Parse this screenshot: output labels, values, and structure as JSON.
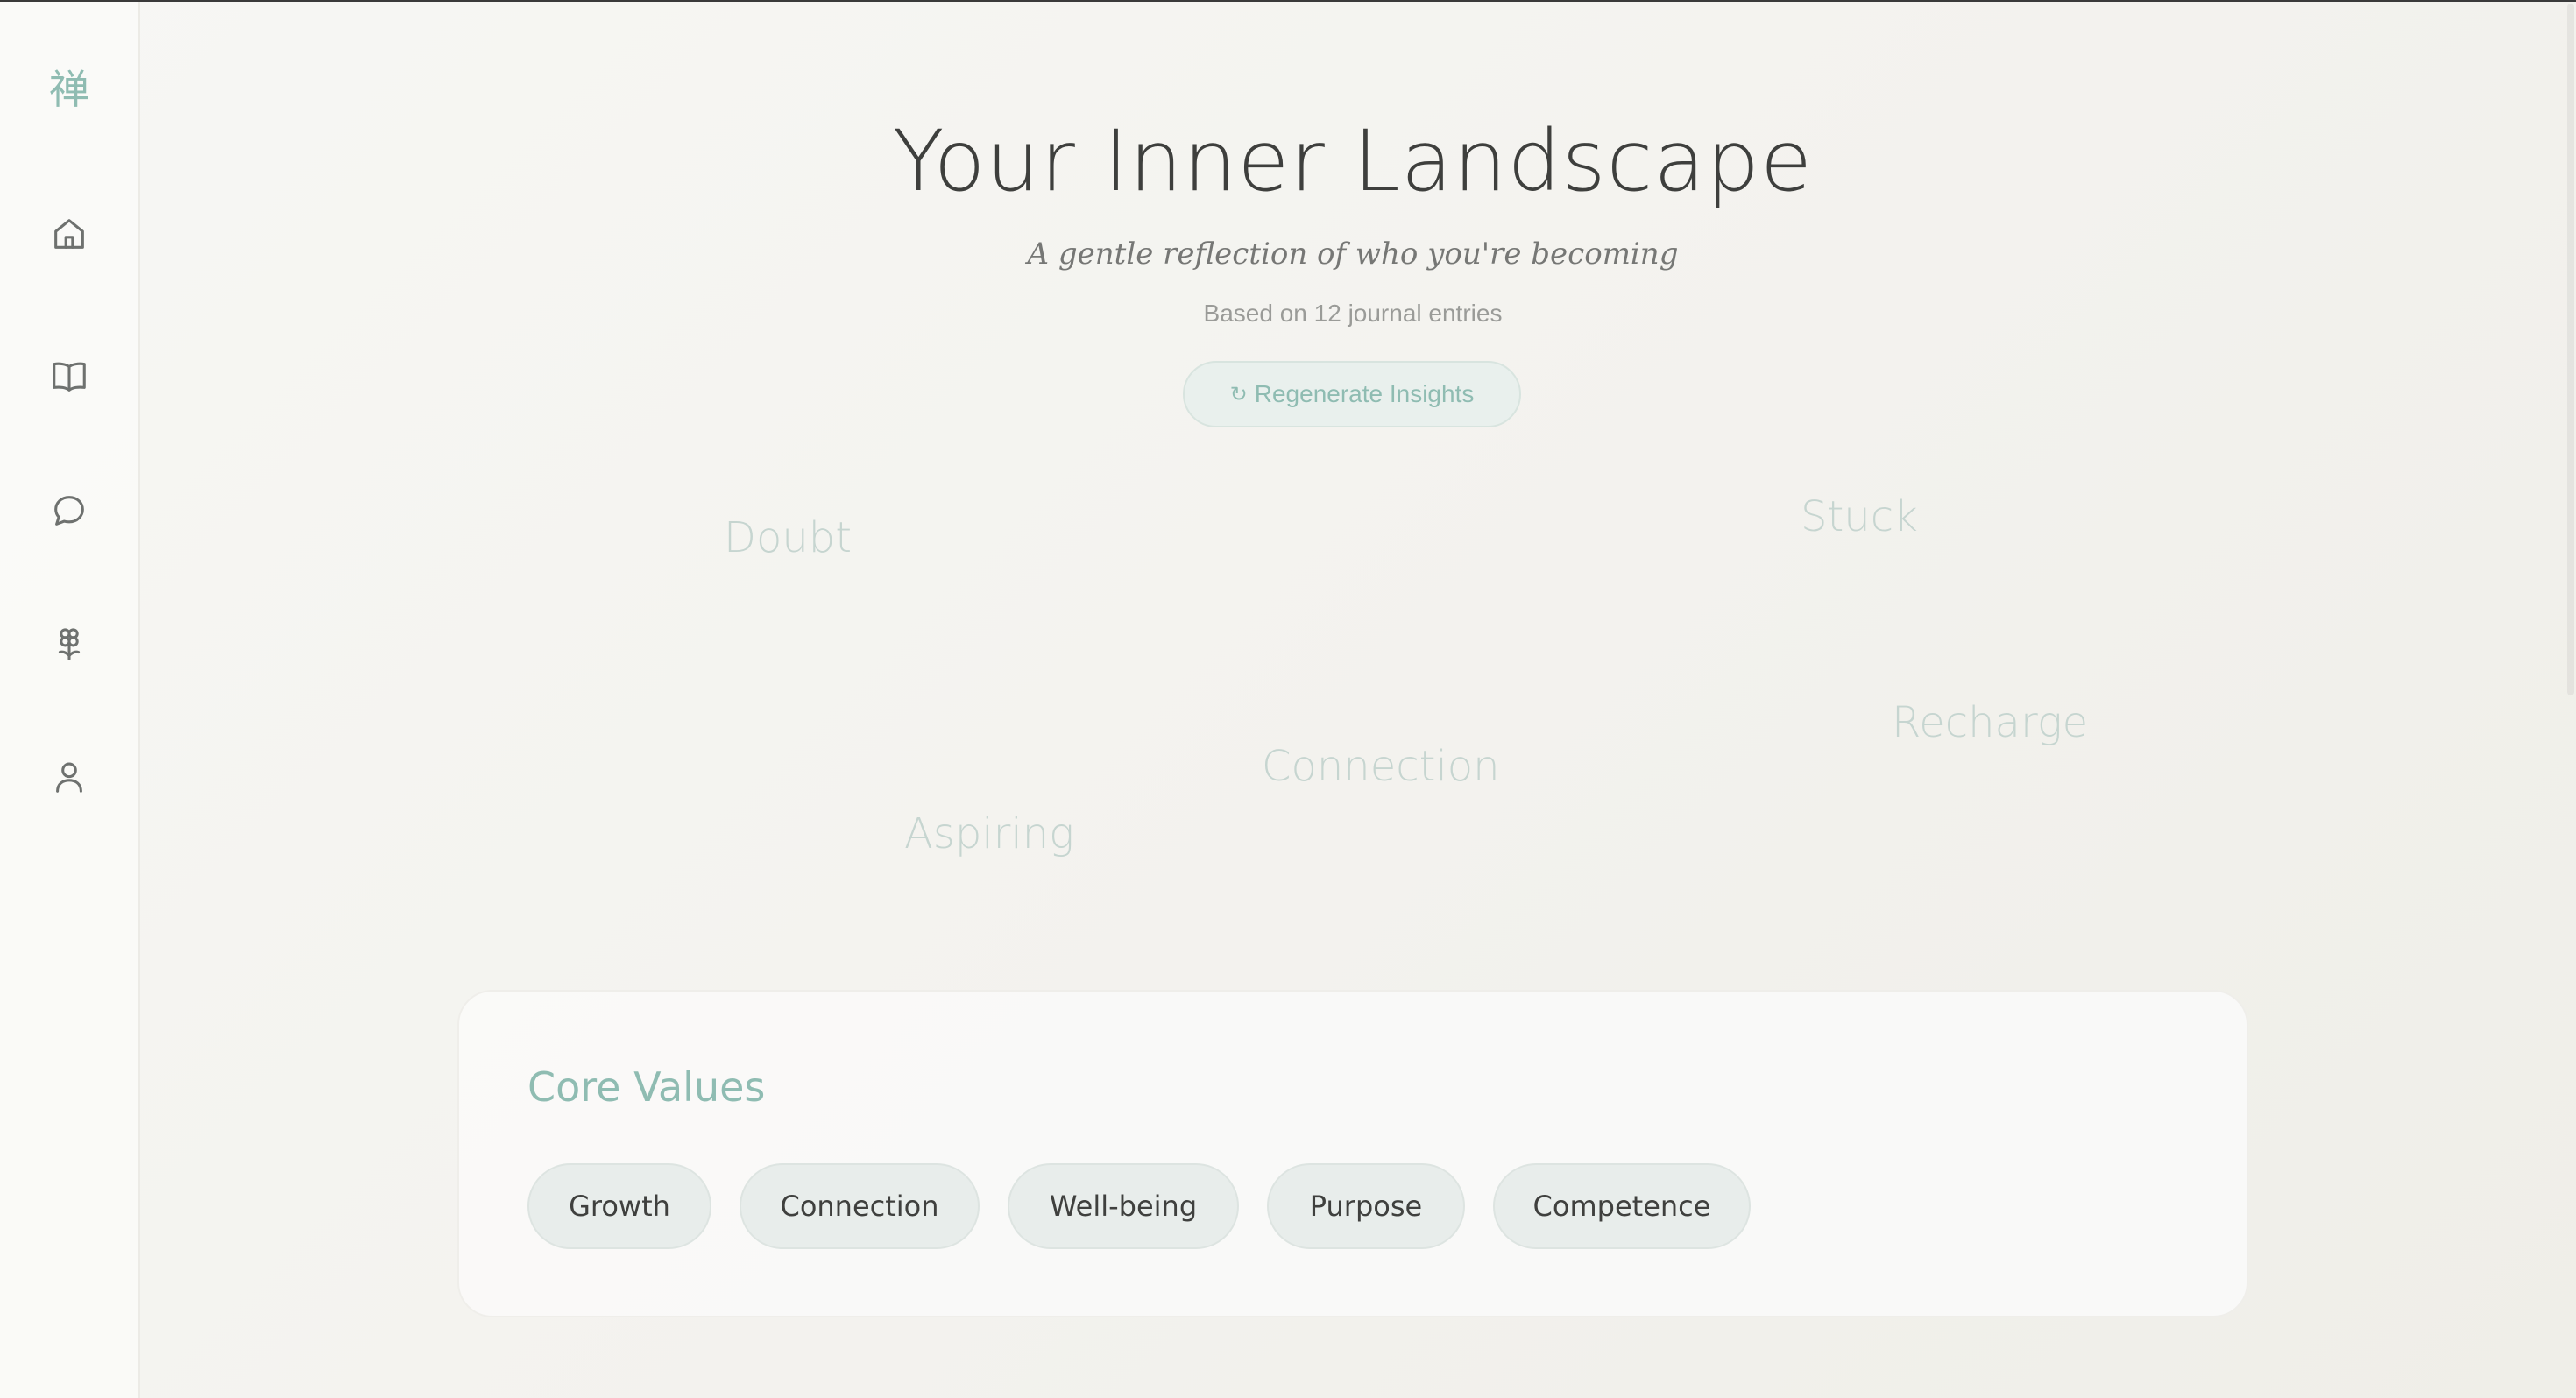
{
  "sidebar": {
    "logo": "禅",
    "items": [
      {
        "icon": "home-icon"
      },
      {
        "icon": "book-icon"
      },
      {
        "icon": "chat-icon"
      },
      {
        "icon": "flower-icon"
      },
      {
        "icon": "user-icon"
      }
    ]
  },
  "header": {
    "title": "Your Inner Landscape",
    "subtitle": "A gentle reflection of who you're becoming",
    "entry_count": "Based on 12 journal entries",
    "regenerate_glyph": "↻",
    "regenerate_label": "Regenerate Insights"
  },
  "emotion_cloud": {
    "words": [
      "Doubt",
      "Stuck",
      "Recharge",
      "Connection",
      "Aspiring"
    ]
  },
  "core_values": {
    "title": "Core Values",
    "chips": [
      "Growth",
      "Connection",
      "Well-being",
      "Purpose",
      "Competence"
    ]
  },
  "colors": {
    "accent": "#8fbcb2",
    "background": "#f4f3ef",
    "chip_background": "#e8edeb",
    "word_cloud": "#c6d5d0"
  }
}
